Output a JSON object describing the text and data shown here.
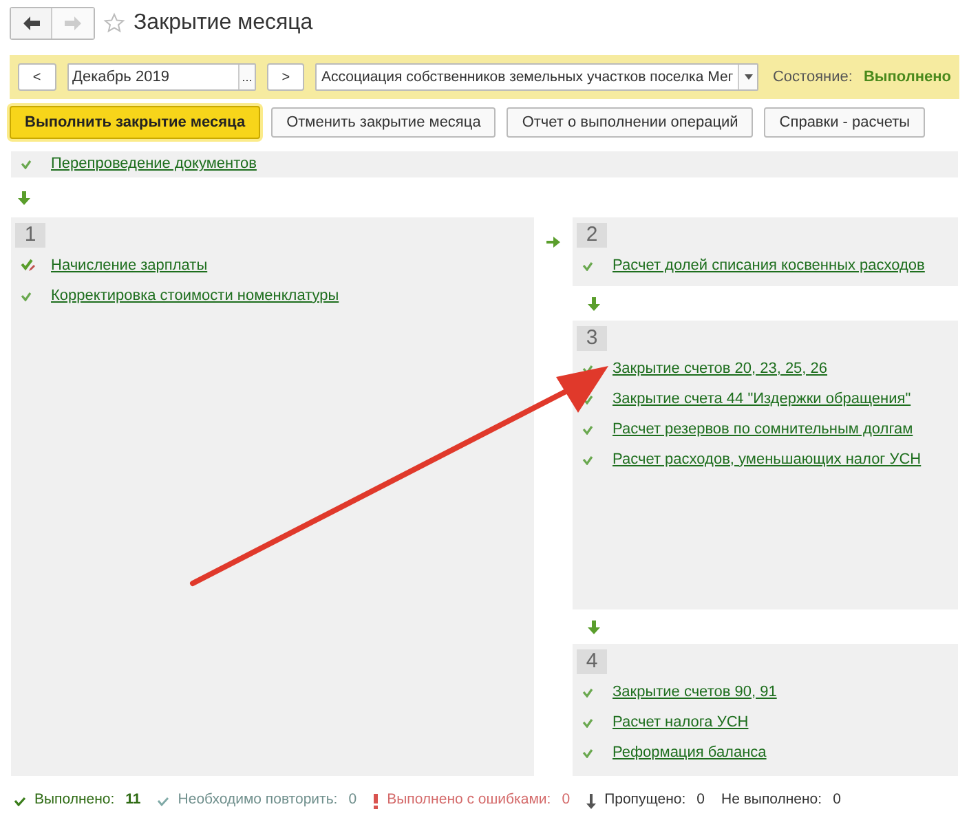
{
  "window": {
    "title": "Закрытие месяца",
    "nav_back": {
      "disabled": false
    },
    "nav_forward": {
      "disabled": true
    },
    "favorite": {
      "on": false
    }
  },
  "toolbar": {
    "prev_label": "<",
    "period": "Декабрь 2019",
    "period_picker": "...",
    "next_label": ">",
    "organization": "Ассоциация собственников земельных участков поселка Мег",
    "state_label": "Состояние:",
    "state_value": "Выполнено"
  },
  "buttons": [
    {
      "label": "Выполнить закрытие месяца",
      "kind": "primary"
    },
    {
      "label": "Отменить закрытие месяца",
      "kind": "normal"
    },
    {
      "label": "Отчет о выполнении операций",
      "kind": "normal"
    },
    {
      "label": "Справки - расчеты",
      "kind": "normal"
    }
  ],
  "pre_step": {
    "items": [
      {
        "label": "Перепроведение документов",
        "kind": "done"
      }
    ]
  },
  "stages": [
    {
      "number": "1",
      "items": [
        {
          "label": "Начисление зарплаты",
          "kind": "done_edited"
        },
        {
          "label": "Корректировка стоимости номенклатуры",
          "kind": "done"
        }
      ]
    },
    {
      "number": "2",
      "items": [
        {
          "label": "Расчет долей списания косвенных расходов",
          "kind": "done"
        }
      ]
    },
    {
      "number": "3",
      "items": [
        {
          "label": "Закрытие счетов 20, 23, 25, 26",
          "kind": "done"
        },
        {
          "label": "Закрытие счета 44 \"Издержки обращения\"",
          "kind": "done"
        },
        {
          "label": "Расчет резервов по сомнительным долгам",
          "kind": "done"
        },
        {
          "label": "Расчет расходов, уменьшающих налог УСН",
          "kind": "done"
        }
      ]
    },
    {
      "number": "4",
      "items": [
        {
          "label": "Закрытие счетов 90, 91",
          "kind": "done"
        },
        {
          "label": "Расчет налога УСН",
          "kind": "done"
        },
        {
          "label": "Реформация баланса",
          "kind": "done"
        }
      ]
    }
  ],
  "summary": [
    {
      "kind": "done",
      "label": "Выполнено:",
      "count": "11"
    },
    {
      "kind": "repeat",
      "label": "Необходимо повторить:",
      "count": "0"
    },
    {
      "kind": "error",
      "label": "Выполнено с ошибками:",
      "count": "0"
    },
    {
      "kind": "skipped",
      "label": "Пропущено:",
      "count": "0"
    },
    {
      "kind": "not_done",
      "label": "Не выполнено:",
      "count": "0"
    }
  ]
}
